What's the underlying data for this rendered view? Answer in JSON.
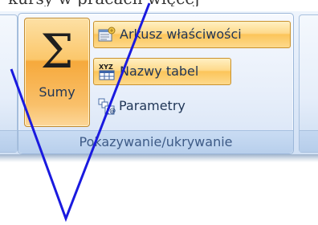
{
  "top_text": "kursy w pracach więcej",
  "group": {
    "label": "Pokazywanie/ukrywanie"
  },
  "buttons": {
    "sumy": {
      "label": "Sumy",
      "icon": "sigma-icon"
    },
    "arkusz": {
      "label": "Arkusz właściwości",
      "icon": "property-sheet-icon"
    },
    "nazwy": {
      "label": "Nazwy tabel",
      "icon": "table-names-icon",
      "icon_text": "XYZ"
    },
    "parametry": {
      "label": "Parametry",
      "icon": "parameters-icon"
    }
  },
  "colors": {
    "ribbon": "#dfe9f7",
    "highlight": "#fbc76b",
    "label_text": "#3d5a86",
    "pen": "#1a1adf"
  }
}
